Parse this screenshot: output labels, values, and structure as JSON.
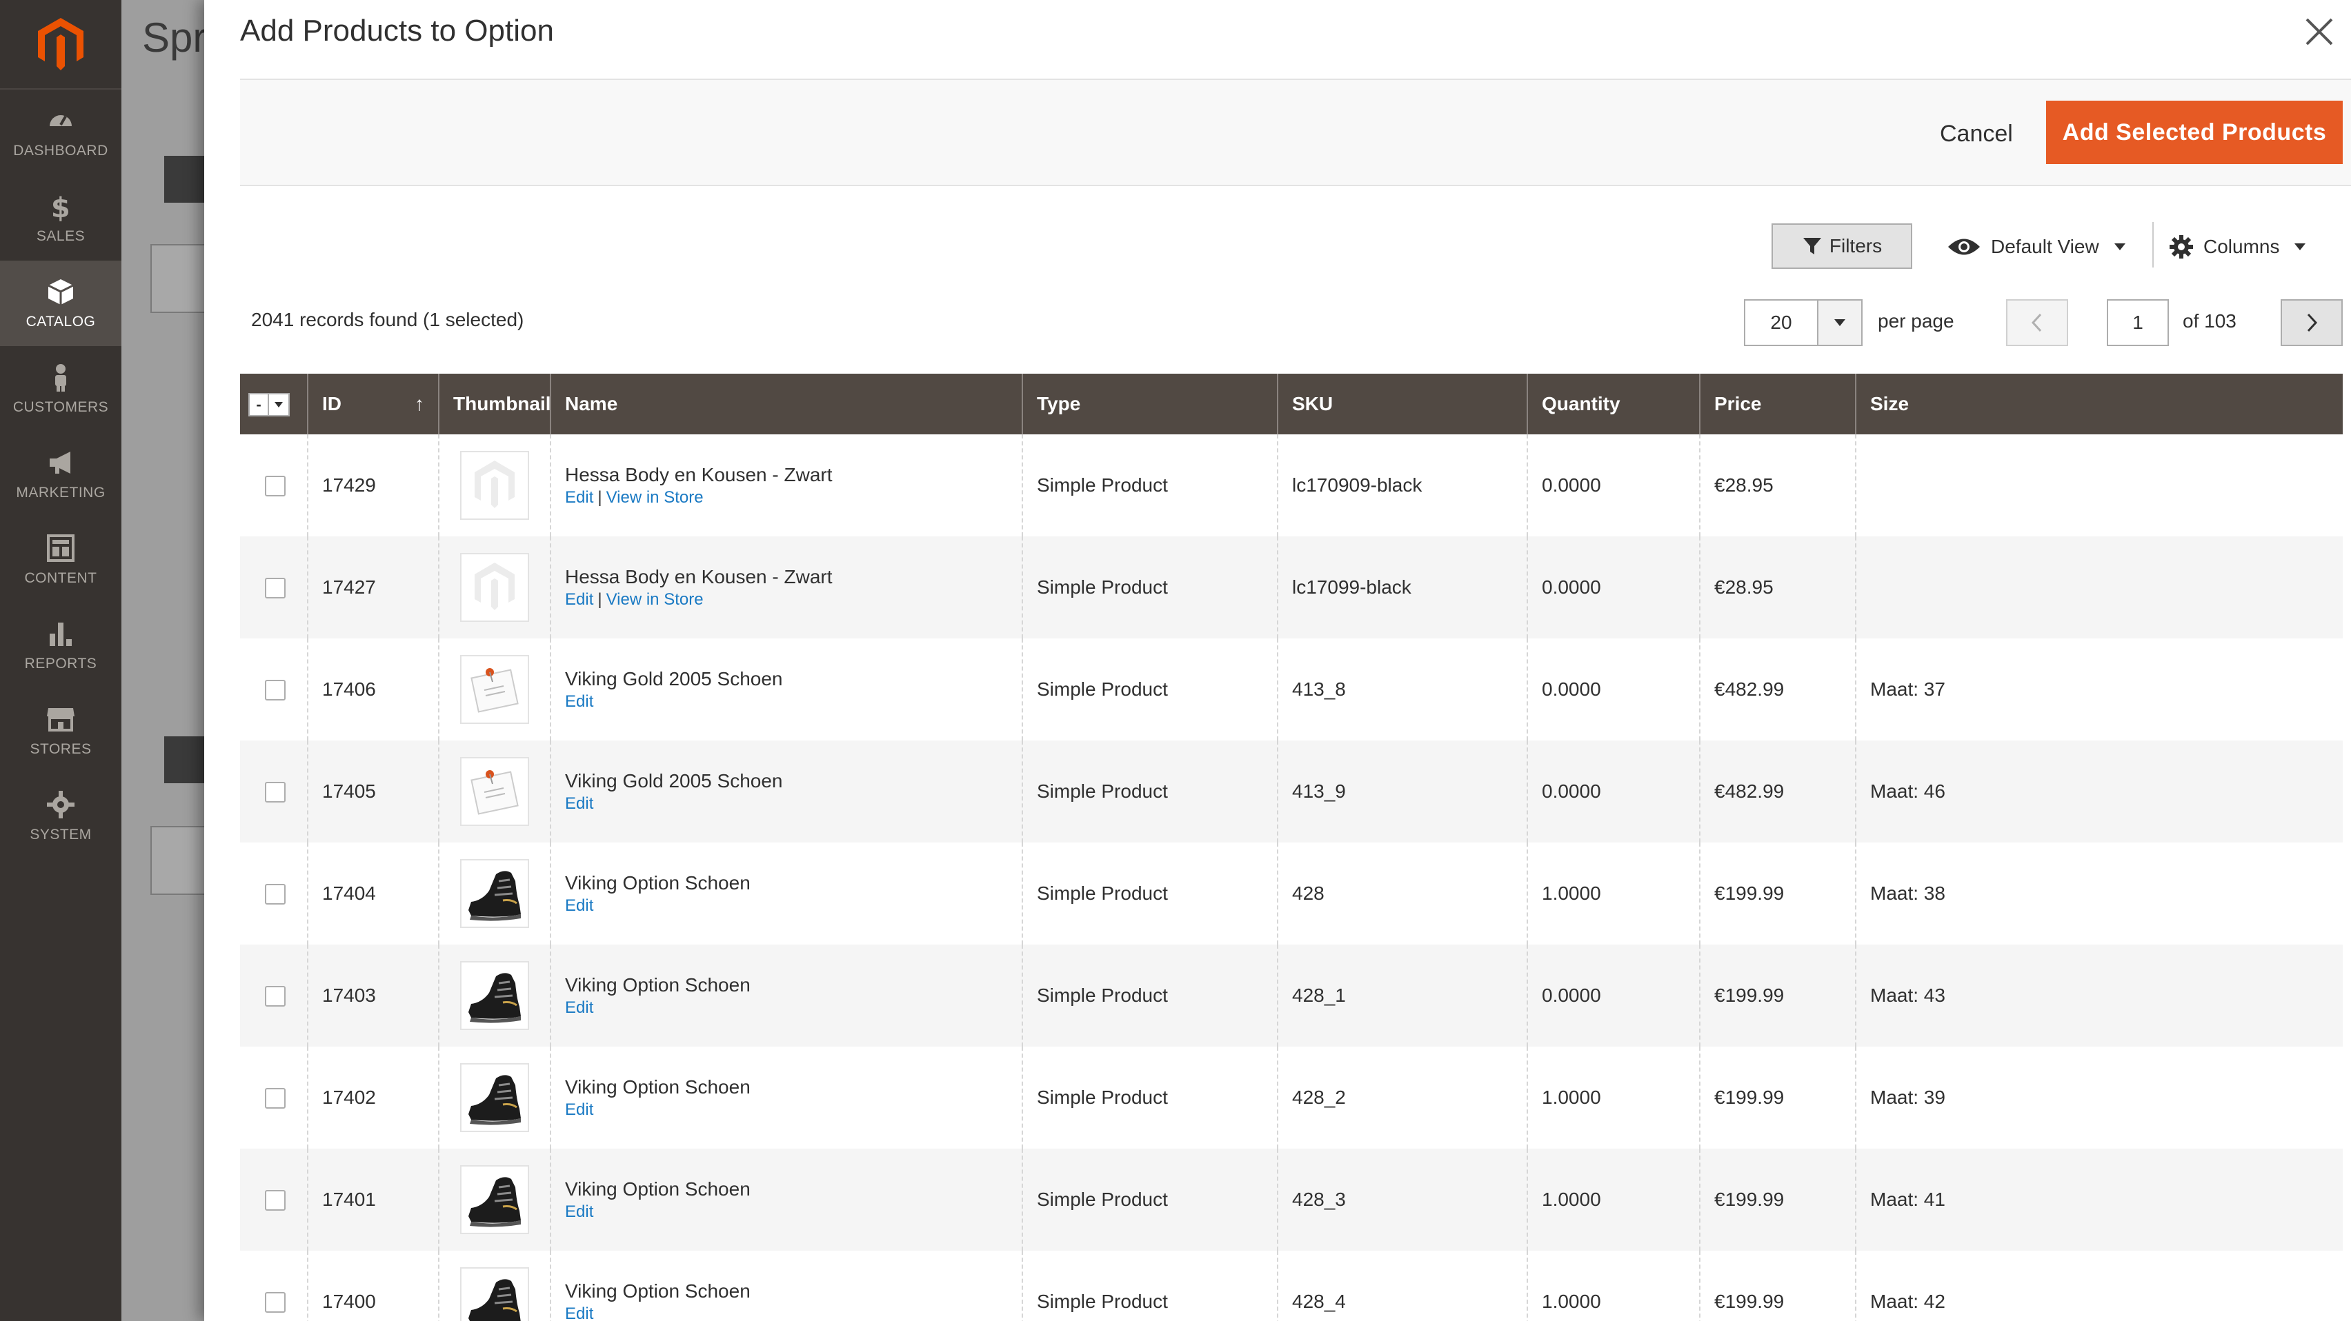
{
  "admin_nav": [
    {
      "label": "DASHBOARD",
      "icon": "dashboard-icon"
    },
    {
      "label": "SALES",
      "icon": "dollar-icon"
    },
    {
      "label": "CATALOG",
      "icon": "box-icon",
      "active": true
    },
    {
      "label": "CUSTOMERS",
      "icon": "person-icon"
    },
    {
      "label": "MARKETING",
      "icon": "megaphone-icon"
    },
    {
      "label": "CONTENT",
      "icon": "layout-icon"
    },
    {
      "label": "REPORTS",
      "icon": "bar-chart-icon"
    },
    {
      "label": "STORES",
      "icon": "store-icon"
    },
    {
      "label": "SYSTEM",
      "icon": "gear-icon"
    }
  ],
  "underlying_page": {
    "title_fragment": "Spr"
  },
  "modal": {
    "title": "Add Products to Option",
    "cancel_label": "Cancel",
    "add_label": "Add Selected Products",
    "accent_color": "#e65a24"
  },
  "toolbar": {
    "filters_label": "Filters",
    "view_label": "Default View",
    "columns_label": "Columns"
  },
  "pagination": {
    "records_text": "2041 records found (1 selected)",
    "per_page_value": "20",
    "per_page_label": "per page",
    "current_page": "1",
    "of_pages": "of 103"
  },
  "grid": {
    "columns": [
      "ID",
      "Thumbnail",
      "Name",
      "Type",
      "SKU",
      "Quantity",
      "Price",
      "Size"
    ],
    "rows": [
      {
        "id": "17429",
        "thumb": "placeholder",
        "name": "Hessa Body en Kousen - Zwart",
        "edit": "Edit",
        "view": "View in Store",
        "type": "Simple Product",
        "sku": "lc170909-black",
        "qty": "0.0000",
        "price": "€28.95",
        "size": ""
      },
      {
        "id": "17427",
        "thumb": "placeholder",
        "name": "Hessa Body en Kousen - Zwart",
        "edit": "Edit",
        "view": "View in Store",
        "type": "Simple Product",
        "sku": "lc17099-black",
        "qty": "0.0000",
        "price": "€28.95",
        "size": ""
      },
      {
        "id": "17406",
        "thumb": "no-photo",
        "name": "Viking Gold 2005 Schoen",
        "edit": "Edit",
        "view": "",
        "type": "Simple Product",
        "sku": "413_8",
        "qty": "0.0000",
        "price": "€482.99",
        "size": "Maat: 37"
      },
      {
        "id": "17405",
        "thumb": "no-photo",
        "name": "Viking Gold 2005 Schoen",
        "edit": "Edit",
        "view": "",
        "type": "Simple Product",
        "sku": "413_9",
        "qty": "0.0000",
        "price": "€482.99",
        "size": "Maat: 46"
      },
      {
        "id": "17404",
        "thumb": "shoe",
        "name": "Viking Option Schoen",
        "edit": "Edit",
        "view": "",
        "type": "Simple Product",
        "sku": "428",
        "qty": "1.0000",
        "price": "€199.99",
        "size": "Maat: 38"
      },
      {
        "id": "17403",
        "thumb": "shoe",
        "name": "Viking Option Schoen",
        "edit": "Edit",
        "view": "",
        "type": "Simple Product",
        "sku": "428_1",
        "qty": "0.0000",
        "price": "€199.99",
        "size": "Maat: 43"
      },
      {
        "id": "17402",
        "thumb": "shoe",
        "name": "Viking Option Schoen",
        "edit": "Edit",
        "view": "",
        "type": "Simple Product",
        "sku": "428_2",
        "qty": "1.0000",
        "price": "€199.99",
        "size": "Maat: 39"
      },
      {
        "id": "17401",
        "thumb": "shoe",
        "name": "Viking Option Schoen",
        "edit": "Edit",
        "view": "",
        "type": "Simple Product",
        "sku": "428_3",
        "qty": "1.0000",
        "price": "€199.99",
        "size": "Maat: 41"
      },
      {
        "id": "17400",
        "thumb": "shoe",
        "name": "Viking Option Schoen",
        "edit": "Edit",
        "view": "",
        "type": "Simple Product",
        "sku": "428_4",
        "qty": "1.0000",
        "price": "€199.99",
        "size": "Maat: 42"
      }
    ]
  }
}
